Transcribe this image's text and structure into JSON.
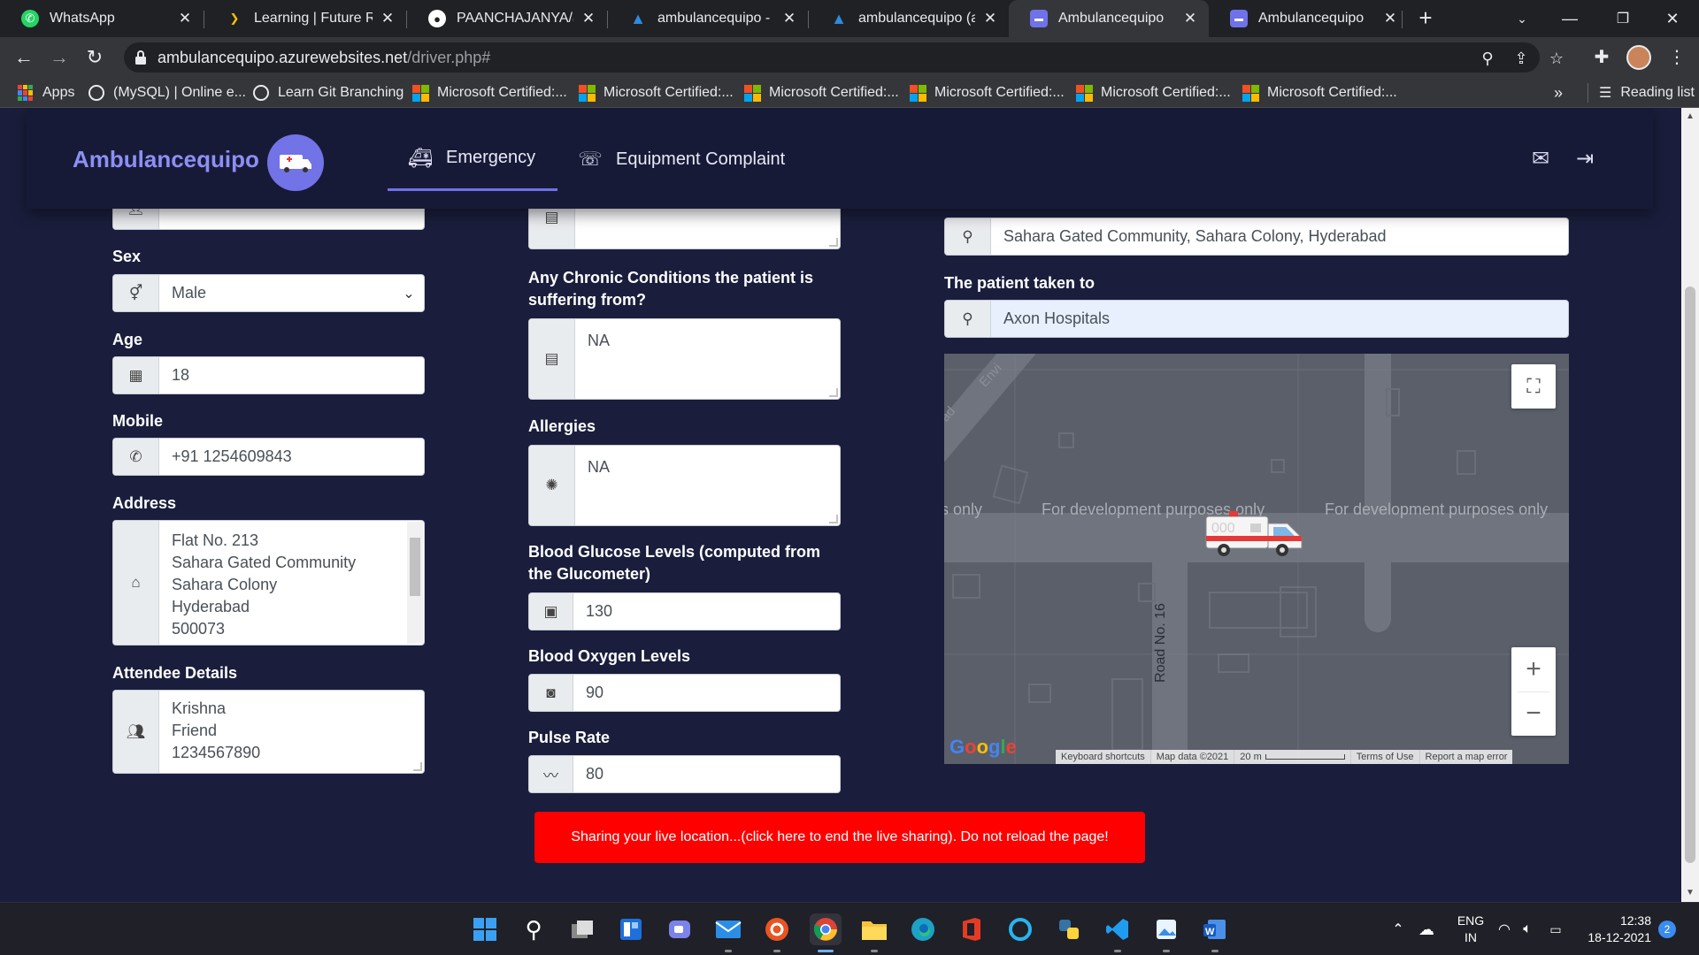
{
  "browser": {
    "tabs": [
      {
        "title": "WhatsApp",
        "icon": "whatsapp-icon",
        "color": "#25d366"
      },
      {
        "title": "Learning | Future Rea",
        "icon": "future-ready-icon",
        "color": "#f5c400"
      },
      {
        "title": "PAANCHAJANYA/amb",
        "icon": "github-icon",
        "color": "#ffffff"
      },
      {
        "title": "ambulancequipo - Mi",
        "icon": "azure-icon",
        "color": "#2f8ae0"
      },
      {
        "title": "ambulancequipo (am",
        "icon": "azure-icon",
        "color": "#2f8ae0"
      },
      {
        "title": "Ambulancequipo",
        "icon": "app-icon",
        "color": "#6f72e8"
      },
      {
        "title": "Ambulancequipo",
        "icon": "app-icon",
        "color": "#6f72e8"
      }
    ],
    "url_host": "ambulancequipo.azurewebsites.net",
    "url_path": "/driver.php#",
    "bookmarks": [
      {
        "label": "Apps",
        "icon": "apps-grid-icon"
      },
      {
        "label": "(MySQL) | Online e...",
        "icon": "globe-icon"
      },
      {
        "label": "Learn Git Branching",
        "icon": "globe-icon"
      },
      {
        "label": "Microsoft Certified:...",
        "icon": "microsoft-icon"
      },
      {
        "label": "Microsoft Certified:...",
        "icon": "microsoft-icon"
      },
      {
        "label": "Microsoft Certified:...",
        "icon": "microsoft-icon"
      },
      {
        "label": "Microsoft Certified:...",
        "icon": "microsoft-icon"
      },
      {
        "label": "Microsoft Certified:...",
        "icon": "microsoft-icon"
      },
      {
        "label": "Microsoft Certified:...",
        "icon": "microsoft-icon"
      }
    ],
    "bookmarks_overflow": "»",
    "reading_list": "Reading list"
  },
  "navbar": {
    "brand": "Ambulancequipo",
    "tabs": [
      {
        "label": "Emergency",
        "icon": "ambulance-icon",
        "active": true
      },
      {
        "label": "Equipment Complaint",
        "icon": "complaint-icon",
        "active": false
      }
    ]
  },
  "form": {
    "sex_label": "Sex",
    "sex_value": "Male",
    "age_label": "Age",
    "age_value": "18",
    "mobile_label": "Mobile",
    "mobile_value": "+91 1254609843",
    "address_label": "Address",
    "address_value": "Flat No. 213\nSahara Gated Community\nSahara Colony\nHyderabad\n500073",
    "attendee_label": "Attendee Details",
    "attendee_value": "Krishna\nFriend\n1234567890",
    "chronic_label": "Any Chronic Conditions the patient is suffering from?",
    "chronic_value": "NA",
    "allergies_label": "Allergies",
    "allergies_value": "NA",
    "glucose_label": "Blood Glucose Levels (computed from the Glucometer)",
    "glucose_value": "130",
    "oxygen_label": "Blood Oxygen Levels",
    "oxygen_value": "90",
    "pulse_label": "Pulse Rate",
    "pulse_value": "80",
    "pickup_value": "Sahara Gated Community, Sahara Colony, Hyderabad",
    "taken_to_label": "The patient taken to",
    "taken_to_value": "Axon Hospitals"
  },
  "map": {
    "watermark_left": "s only",
    "watermark_mid": "For development purposes only",
    "watermark_right": "For development purposes only",
    "road_label": "Road No. 16",
    "road_label_top": "Envi",
    "road_label_left": "ad",
    "google": "Google",
    "footer": [
      "Keyboard shortcuts",
      "Map data ©2021",
      "20 m",
      "Terms of Use",
      "Report a map error"
    ]
  },
  "live_sharing_button": "Sharing your live location...(click here to end the live sharing). Do not reload the page!",
  "taskbar": {
    "apps": [
      "windows-start-icon",
      "search-icon",
      "task-view-icon",
      "widgets-icon",
      "teams-chat-icon",
      "mail-icon",
      "ubuntu-icon",
      "chrome-icon",
      "file-explorer-icon",
      "edge-icon",
      "office-icon",
      "cortana-icon",
      "python-icon",
      "vscode-icon",
      "photos-icon",
      "word-icon"
    ],
    "lang_top": "ENG",
    "lang_bottom": "IN",
    "time": "12:38",
    "date": "18-12-2021",
    "notifications": "2"
  }
}
